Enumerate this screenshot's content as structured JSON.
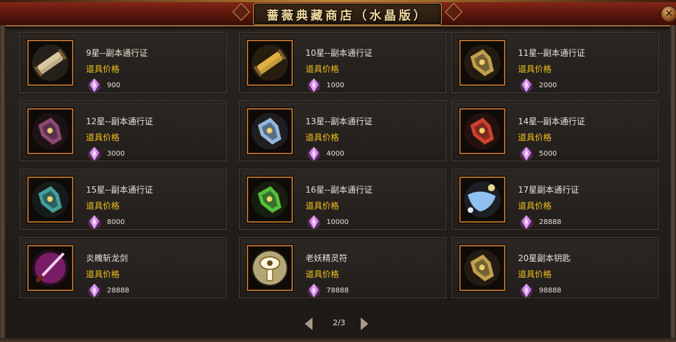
{
  "window": {
    "title": "蔷薇典藏商店（水晶版）",
    "close_icon": "close-icon"
  },
  "items": [
    {
      "name": "9星--副本通行证",
      "price_label": "道具价格",
      "price": "900",
      "icon": "scroll-bundle-icon",
      "color": "#d8c8a0"
    },
    {
      "name": "10星--副本通行证",
      "price_label": "道具价格",
      "price": "1000",
      "icon": "golden-scroll-icon",
      "color": "#e0b040"
    },
    {
      "name": "11星--副本通行证",
      "price_label": "道具价格",
      "price": "2000",
      "icon": "ornate-scepter-icon",
      "color": "#c0a050"
    },
    {
      "name": "12星--副本通行证",
      "price_label": "道具价格",
      "price": "3000",
      "icon": "demon-gauntlet-icon",
      "color": "#8a4a7a"
    },
    {
      "name": "13星--副本通行证",
      "price_label": "道具价格",
      "price": "4000",
      "icon": "frost-gauntlet-icon",
      "color": "#90b8e0"
    },
    {
      "name": "14星--副本通行证",
      "price_label": "道具价格",
      "price": "5000",
      "icon": "fire-gauntlet-icon",
      "color": "#d04030"
    },
    {
      "name": "15星--副本通行证",
      "price_label": "道具价格",
      "price": "8000",
      "icon": "jade-bracer-icon",
      "color": "#40a0a0"
    },
    {
      "name": "16星--副本通行证",
      "price_label": "道具价格",
      "price": "10000",
      "icon": "emerald-gauntlet-icon",
      "color": "#50c040"
    },
    {
      "name": "17星副本通行证",
      "price_label": "道具价格",
      "price": "28888",
      "icon": "blue-scroll-icon",
      "color": "#90c0f0"
    },
    {
      "name": "炎魄斩龙剑",
      "price_label": "道具价格",
      "price": "28888",
      "icon": "flame-sword-icon",
      "color": "#e030c0"
    },
    {
      "name": "老妖精灵符",
      "price_label": "道具价格",
      "price": "78888",
      "icon": "spirit-talisman-icon",
      "color": "#f0e0a0"
    },
    {
      "name": "20星副本钥匙",
      "price_label": "道具价格",
      "price": "98888",
      "icon": "dungeon-key-icon",
      "color": "#c0a050"
    }
  ],
  "currency_icon": "crystal-icon",
  "pager": {
    "page": "2/3",
    "prev_icon": "arrow-left-icon",
    "next_icon": "arrow-right-icon"
  },
  "colors": {
    "title_bar": "#6a1a0e",
    "price_label": "#f0c020",
    "icon_border": "#b06a2a",
    "crystal": "#d070f0"
  }
}
